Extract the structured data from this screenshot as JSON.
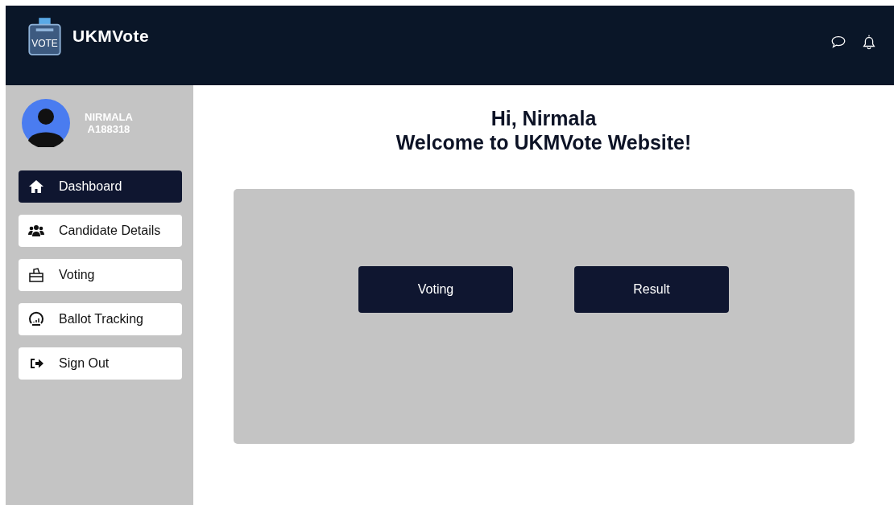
{
  "header": {
    "brand": "UKMVote",
    "logo_text": "VOTE"
  },
  "user": {
    "name": "NIRMALA",
    "id": "A188318"
  },
  "nav": [
    {
      "label": "Dashboard",
      "kind": "home",
      "selected": true
    },
    {
      "label": "Candidate Details",
      "kind": "users",
      "selected": false
    },
    {
      "label": "Voting",
      "kind": "ballot",
      "selected": false
    },
    {
      "label": "Ballot Tracking",
      "kind": "gauge",
      "selected": false
    },
    {
      "label": "Sign Out",
      "kind": "signout",
      "selected": false
    }
  ],
  "greeting": {
    "line_1": "Hi, Nirmala",
    "line_2": "Welcome to UKMVote Website!"
  },
  "buttons": [
    "Voting",
    "Result"
  ]
}
